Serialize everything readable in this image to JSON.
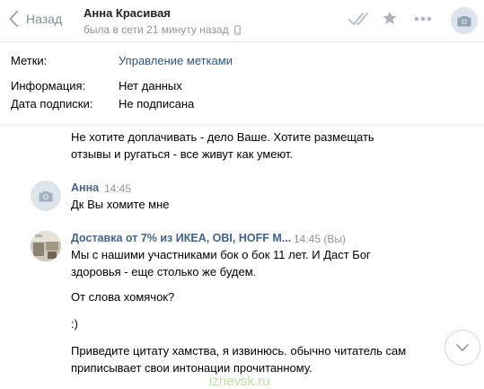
{
  "header": {
    "back_label": "Назад",
    "contact_name": "Анна Красивая",
    "contact_status": "была в сети 21 минуту назад",
    "icons": [
      "check-double-icon",
      "star-icon",
      "more-icon",
      "camera-icon"
    ]
  },
  "info": {
    "rows": [
      {
        "key": "Метки:",
        "value": "Управление метками",
        "is_link": true
      },
      {
        "key": "Информация:",
        "value": "Нет данных",
        "is_link": false
      },
      {
        "key": "Дата подписки:",
        "value": "Не подписана",
        "is_link": false
      }
    ]
  },
  "messages": {
    "continuation": [
      "Не хотите доплачивать - дело Ваше. Хотите размещать",
      "отзывы и ругаться - все живут как умеют."
    ],
    "msg2": {
      "author": "Анна",
      "time": "14:45",
      "text": "Дк Вы хомите мне"
    },
    "msg3": {
      "author": "Доставка от 7% из ИКЕА, OBI, HOFF M...",
      "time": "14:45 (Вы)",
      "lines": [
        "Мы с нашими участниками бок о бок 11 лет. И Даст Бог",
        "здоровья - еще столько же будем.",
        "От слова хомячок?",
        ":)",
        "Приведите цитату хамства, я извинюсь. обычно читатель сам",
        "приписывает свои интонации прочитанному."
      ]
    }
  },
  "watermark": "izhevsk.ru",
  "colors": {
    "link": "#2a5885",
    "author": "#42648b",
    "muted": "#939393",
    "icon": "#828a99"
  }
}
